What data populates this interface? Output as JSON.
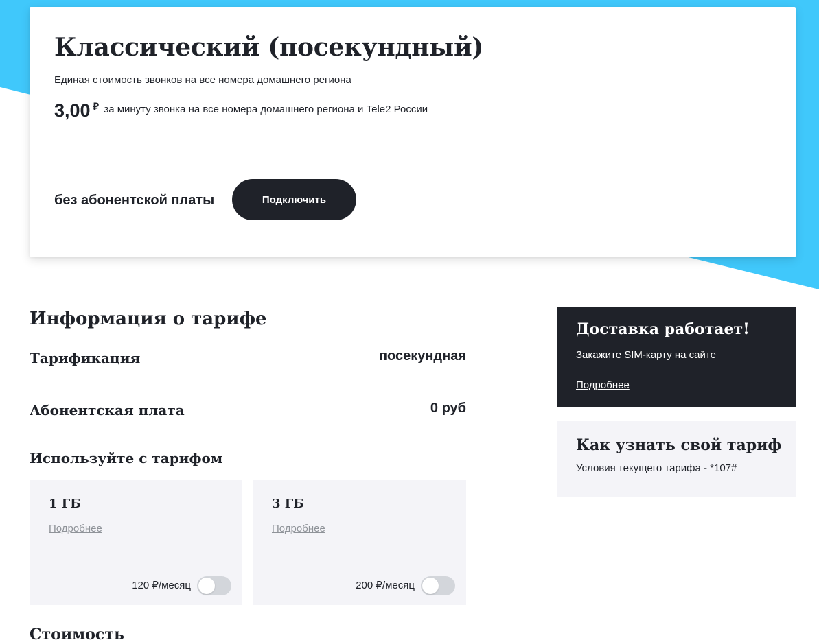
{
  "colors": {
    "accent": "#40c8fb",
    "dark": "#1f2229",
    "card_bg": "#f4f4f8",
    "toggle_off": "#d3d6db",
    "muted_link": "#8f9399"
  },
  "hero": {
    "title": "Классический (посекундный)",
    "subtitle": "Единая стоимость звонков на все номера домашнего региона",
    "price_amount": "3,00",
    "price_currency": "₽",
    "price_desc": "за минуту звонка на все номера домашнего региона и Tele2 России",
    "fee_label": "без абонентской платы",
    "connect_label": "Подключить"
  },
  "info": {
    "title": "Информация о тарифе",
    "rows": [
      {
        "key": "Тарификация",
        "value": "посекундная"
      },
      {
        "key": "Абонентская плата",
        "value": "0 руб"
      }
    ],
    "use_title": "Используйте с тарифом",
    "addons": [
      {
        "name": "1 ГБ",
        "link": "Подробнее",
        "price": "120 ₽/месяц",
        "enabled": false
      },
      {
        "name": "3 ГБ",
        "link": "Подробнее",
        "price": "200 ₽/месяц",
        "enabled": false
      }
    ],
    "cost_title": "Стоимость"
  },
  "sidebar": {
    "delivery": {
      "title": "Доставка работает!",
      "text": "Закажите SIM-карту на сайте",
      "link": "Подробнее"
    },
    "check": {
      "title": "Как узнать свой тариф",
      "text": "Условия текущего тарифа - *107#"
    }
  }
}
